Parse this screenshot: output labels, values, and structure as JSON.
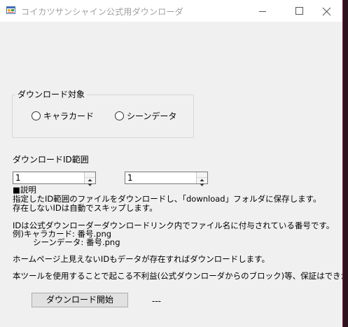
{
  "window": {
    "title": "コイカツサンシャイン公式用ダウンローダ",
    "controls": [
      "minimize-icon",
      "maximize-icon",
      "close-icon"
    ]
  },
  "download_target": {
    "legend": "ダウンロード対象",
    "options": [
      {
        "label": "キャラカード",
        "selected": false
      },
      {
        "label": "シーンデータ",
        "selected": false
      }
    ]
  },
  "id_range": {
    "label": "ダウンロードID範囲",
    "start_value": "1",
    "end_value": "1"
  },
  "description": {
    "heading": "■説明",
    "line1": "指定したID範囲のファイルをダウンロードし、「download」フォルダに保存します。",
    "line2": "存在しないIDは自動でスキップします。",
    "line3": "IDは公式ダウンローダーダウンロードリンク内でファイル名に付与されている番号です。",
    "line4": "例)キャラカード: 番号.png",
    "line5": "シーンデータ: 番号.png",
    "line6": "ホームページ上見えないIDもデータが存在すればダウンロードします。",
    "line7": "本ツールを使用することで起こる不利益(公式ダウンローダからのブロック)等、保証はできかねます。"
  },
  "actions": {
    "start_button": "ダウンロード開始",
    "status": "---"
  }
}
